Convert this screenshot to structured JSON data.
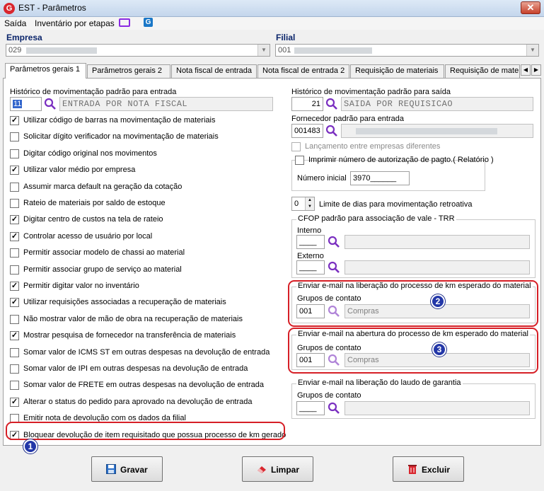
{
  "window": {
    "title": "EST - Parâmetros",
    "app_icon_letter": "G",
    "close_glyph": "✕"
  },
  "menu": {
    "items": [
      "Saída",
      "Inventário por etapas"
    ]
  },
  "toolbar_icons": [
    "monitor-icon",
    "g-logo-icon"
  ],
  "empresa": {
    "label": "Empresa",
    "value": "029"
  },
  "filial": {
    "label": "Filial",
    "value": "001"
  },
  "tabs": [
    "Parâmetros gerais 1",
    "Parâmetros gerais 2",
    "Nota fiscal de entrada",
    "Nota fiscal de entrada 2",
    "Requisição de materiais",
    "Requisição de materi"
  ],
  "left": {
    "hist_entrada_label": "Histórico de movimentação padrão para entrada",
    "hist_entrada_code": "11",
    "hist_entrada_desc": "ENTRADA POR NOTA FISCAL",
    "checkboxes": [
      {
        "label": "Utilizar código de barras na movimentação de materiais",
        "checked": true
      },
      {
        "label": "Solicitar dígito verificador na movimentação de materiais",
        "checked": false
      },
      {
        "label": "Digitar código original nos movimentos",
        "checked": false
      },
      {
        "label": "Utilizar valor médio por empresa",
        "checked": true
      },
      {
        "label": "Assumir marca default na geração da cotação",
        "checked": false
      },
      {
        "label": "Rateio de materiais por saldo de estoque",
        "checked": false
      },
      {
        "label": "Digitar centro de custos na tela de rateio",
        "checked": true
      },
      {
        "label": "Controlar acesso de usuário por local",
        "checked": true
      },
      {
        "label": "Permitir associar modelo de chassi ao material",
        "checked": false
      },
      {
        "label": "Permitir associar grupo de serviço ao material",
        "checked": false
      },
      {
        "label": "Permitir digitar valor no inventário",
        "checked": true
      },
      {
        "label": "Utilizar requisições associadas a recuperação de materiais",
        "checked": true
      },
      {
        "label": "Não mostrar valor de mão de obra na recuperação de materiais",
        "checked": false
      },
      {
        "label": "Mostrar pesquisa de fornecedor na transferência de materiais",
        "checked": true
      },
      {
        "label": "Somar valor de ICMS ST em outras despesas na devolução de entrada",
        "checked": false
      },
      {
        "label": "Somar valor de IPI em outras despesas na devolução de entrada",
        "checked": false
      },
      {
        "label": "Somar valor de FRETE em outras despesas na devolução de entrada",
        "checked": false
      },
      {
        "label": "Alterar o status do pedido para aprovado na devolução de entrada",
        "checked": true
      },
      {
        "label": "Emitir nota de devolução com os dados da filial",
        "checked": false
      },
      {
        "label": "Bloquear devolução de item requisitado que possua processo de km gerado",
        "checked": true
      }
    ]
  },
  "right": {
    "hist_saida_label": "Histórico de movimentação padrão para saída",
    "hist_saida_code": "21",
    "hist_saida_desc": "SAIDA POR REQUISICAO",
    "fornecedor_label": "Fornecedor padrão para entrada",
    "fornecedor_code": "001483",
    "lanc_label": "Lançamento entre empresas diferentes",
    "imprimir_label": "Imprimir número de autorização de pagto.( Relatório )",
    "numero_inicial_label": "Número inicial",
    "numero_inicial_value": "3970______",
    "limite_value": "0",
    "limite_label": "Limite de dias para movimentação retroativa",
    "cfop_title": "CFOP padrão para associação de vale - TRR",
    "interno_label": "Interno",
    "interno_value": "____",
    "externo_label": "Externo",
    "externo_value": "____",
    "km_liberacao_title": "Enviar e-mail na liberação do processo de km esperado do material",
    "km_liberacao_grupos": "Grupos de contato",
    "km_liberacao_code": "001",
    "km_liberacao_desc": "Compras",
    "km_abertura_title": "Enviar e-mail na abertura do processo de km esperado do material",
    "km_abertura_grupos": "Grupos de contato",
    "km_abertura_code": "001",
    "km_abertura_desc": "Compras",
    "laudo_title": "Enviar e-mail na liberação do laudo de garantia",
    "laudo_grupos": "Grupos de contato",
    "laudo_code": "____"
  },
  "annotations": {
    "badge1": "1",
    "badge2": "2",
    "badge3": "3"
  },
  "buttons": {
    "gravar": "Gravar",
    "limpar": "Limpar",
    "excluir": "Excluir"
  },
  "colors": {
    "annotation_red": "#d61f26",
    "badge_blue": "#2337a8",
    "search_icon": "#7a2fc0"
  }
}
